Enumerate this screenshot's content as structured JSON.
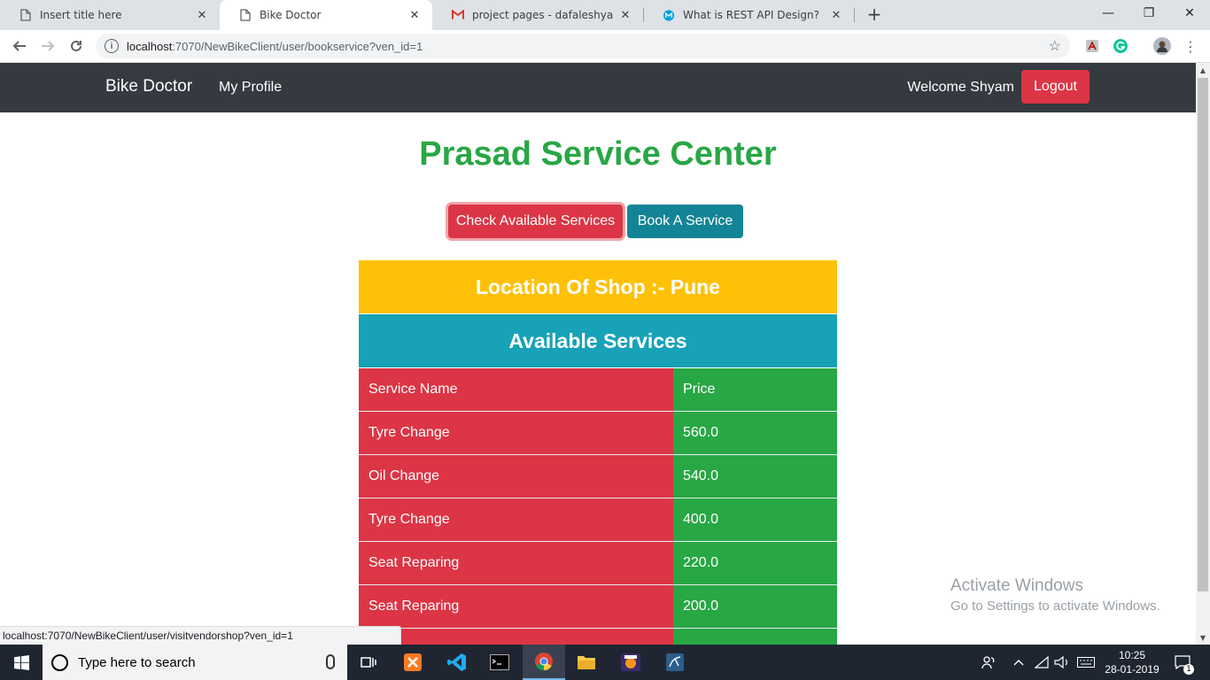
{
  "browser": {
    "tabs": [
      {
        "title": "Insert title here",
        "icon": "page-icon"
      },
      {
        "title": "Bike Doctor",
        "icon": "page-icon"
      },
      {
        "title": "project pages - dafaleshyam@gn",
        "icon": "gmail-icon"
      },
      {
        "title": "What is REST API Design? | Mule",
        "icon": "mulesoft-icon"
      }
    ],
    "url_host": "localhost",
    "url_rest": ":7070/NewBikeClient/user/bookservice?ven_id=1",
    "status_url": "localhost:7070/NewBikeClient/user/visitvendorshop?ven_id=1"
  },
  "navbar": {
    "brand": "Bike Doctor",
    "profile_link": "My Profile",
    "welcome": "Welcome Shyam",
    "logout": "Logout"
  },
  "page": {
    "title": "Prasad Service Center",
    "check_button": "Check Available Services",
    "book_button": "Book A Service",
    "location": "Location Of Shop :- Pune",
    "services_heading": "Available Services",
    "table_header": {
      "name": "Service Name",
      "price": "Price"
    },
    "services": [
      {
        "name": "Tyre Change",
        "price": "560.0"
      },
      {
        "name": "Oil Change",
        "price": "540.0"
      },
      {
        "name": "Tyre Change",
        "price": "400.0"
      },
      {
        "name": "Seat Reparing",
        "price": "220.0"
      },
      {
        "name": "Seat Reparing",
        "price": "200.0"
      },
      {
        "name": "",
        "price": ""
      }
    ]
  },
  "watermark": {
    "line1": "Activate Windows",
    "line2": "Go to Settings to activate Windows."
  },
  "taskbar": {
    "search_placeholder": "Type here to search",
    "time": "10:25",
    "date": "28-01-2019",
    "notification_count": "1"
  },
  "colors": {
    "navbar": "#343a40",
    "danger": "#dc3545",
    "success": "#28a745",
    "info": "#17a2b8",
    "warning": "#ffc107"
  }
}
